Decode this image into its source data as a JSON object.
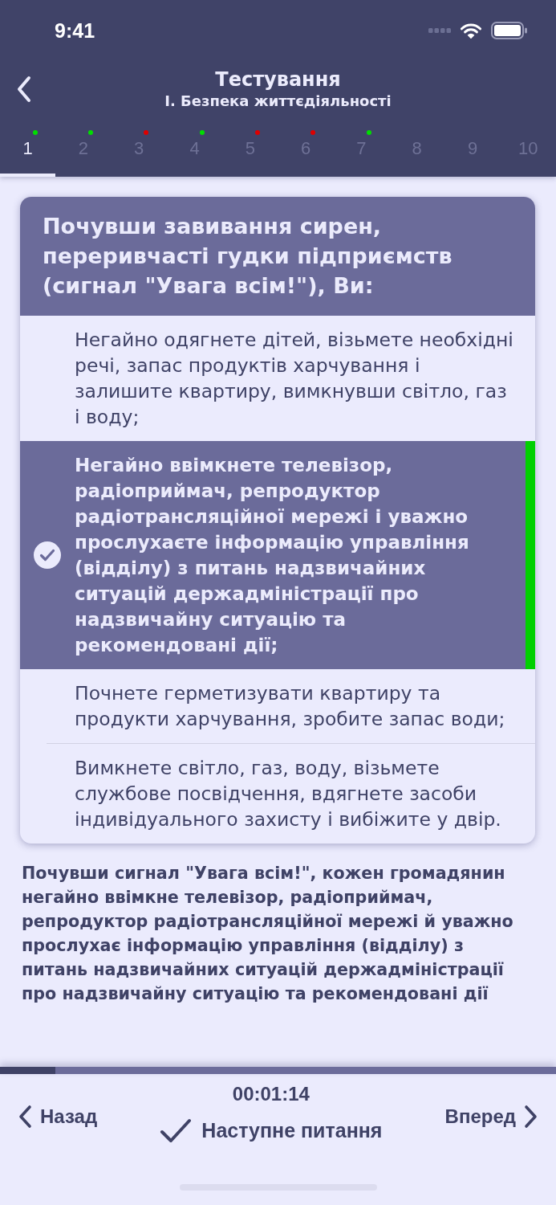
{
  "status_bar": {
    "time": "9:41"
  },
  "nav": {
    "title": "Тестування",
    "subtitle": "I. Безпека життєдіяльності"
  },
  "question_tabs": [
    {
      "label": "1",
      "selected": true,
      "color": "#00dd00"
    },
    {
      "label": "2",
      "selected": false,
      "color": "#00dd00"
    },
    {
      "label": "3",
      "selected": false,
      "color": "#dd0000"
    },
    {
      "label": "4",
      "selected": false,
      "color": "#00dd00"
    },
    {
      "label": "5",
      "selected": false,
      "color": "#dd0000"
    },
    {
      "label": "6",
      "selected": false,
      "color": "#dd0000"
    },
    {
      "label": "7",
      "selected": false,
      "color": "#00dd00"
    },
    {
      "label": "8",
      "selected": false
    },
    {
      "label": "9",
      "selected": false
    },
    {
      "label": "10",
      "selected": false
    }
  ],
  "question": {
    "text": "Почувши завивання сирен, переривчасті гудки підприємств (сигнал \"Увага всім!\"), Ви:",
    "answers": [
      {
        "text": "Негайно одягнете дітей, візьмете необхідні речі, запас продуктів харчування і залишите квартиру, вимкнувши світло, газ і воду;",
        "selected": false,
        "correct": false
      },
      {
        "text": "Негайно ввімкнете телевізор, радіоприймач, репродуктор радіотрансляційної мережі і уважно прослухаєте інформацію управління (відділу) з питань надзвичайних ситуацій держадміністрації про надзвичайну ситуацію та рекомендовані дії;",
        "selected": true,
        "correct": true
      },
      {
        "text": "Почнете герметизувати квартиру та продукти харчування, зробите запас води;",
        "selected": false,
        "correct": false
      },
      {
        "text": "Вимкнете світло, газ, воду, візьмете службове посвідчення, вдягнете засоби індивідуального захисту і вибіжите у двір.",
        "selected": false,
        "correct": false
      }
    ]
  },
  "explanation": "Почувши сигнал \"Увага всім!\", кожен громадянин негайно ввімкне телевізор, радіоприймач, репродуктор радіотрансляційної мережі й уважно прослухає інформацію управління (відділу) з питань надзвичайних ситуацій держадміністрації про надзвичайну ситуацію та рекомендовані дії",
  "footer": {
    "progress": {
      "level": 0.1
    },
    "timer": "00:01:14",
    "back": "Назад",
    "next_question": "Наступне питання",
    "forward": "Вперед"
  }
}
